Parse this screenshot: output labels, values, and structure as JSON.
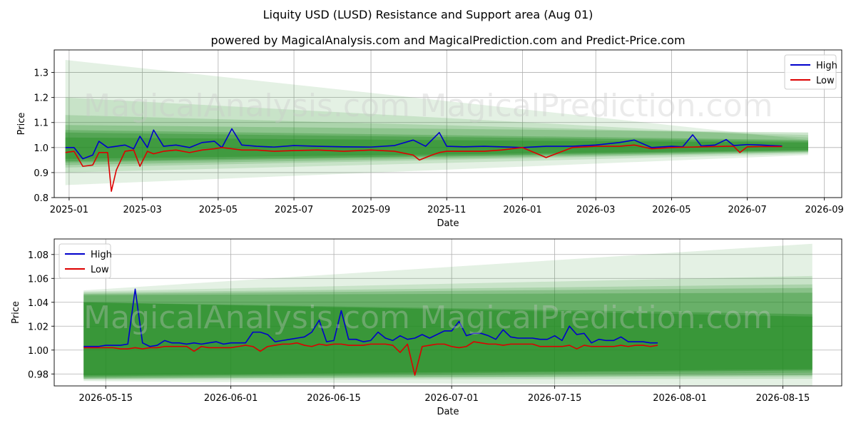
{
  "figure": {
    "title": "Liquity USD (LUSD) Resistance and Support area (Aug 01)",
    "subtitle": "powered by MagicalAnalysis.com and MagicalPrediction.com and Predict-Price.com",
    "watermarks": [
      "MagicalAnalysis.com",
      "MagicalPrediction.com"
    ]
  },
  "colors": {
    "high": "#0000cc",
    "low": "#dd0000",
    "band": "#228b22",
    "grid": "#b0b0b0"
  },
  "chart_data": [
    {
      "type": "line",
      "xlabel": "Date",
      "ylabel": "Price",
      "xlim": [
        "2024-12-20",
        "2026-09-15"
      ],
      "ylim": [
        0.8,
        1.39
      ],
      "grid": true,
      "legend": "top-right",
      "x_ticks": [
        "2025-01",
        "2025-03",
        "2025-05",
        "2025-07",
        "2025-09",
        "2025-11",
        "2026-01",
        "2026-03",
        "2026-05",
        "2026-07",
        "2026-09"
      ],
      "x_tick_dates": [
        "2025-01-01",
        "2025-03-01",
        "2025-05-01",
        "2025-07-01",
        "2025-09-01",
        "2025-11-01",
        "2026-01-01",
        "2026-03-01",
        "2026-05-01",
        "2026-07-01",
        "2026-09-01"
      ],
      "y_ticks": [
        "0.8",
        "0.9",
        "1.0",
        "1.1",
        "1.2",
        "1.3"
      ],
      "y_tick_values": [
        0.8,
        0.9,
        1.0,
        1.1,
        1.2,
        1.3
      ],
      "band_start": "2024-12-29",
      "band_end": "2026-08-19",
      "bands": [
        {
          "start": [
            0.85,
            1.35
          ],
          "end": [
            0.97,
            1.03
          ],
          "opacity": 0.12
        },
        {
          "start": [
            0.9,
            1.2
          ],
          "end": [
            0.975,
            1.04
          ],
          "opacity": 0.14
        },
        {
          "start": [
            0.92,
            1.13
          ],
          "end": [
            0.98,
            1.05
          ],
          "opacity": 0.16
        },
        {
          "start": [
            0.93,
            1.09
          ],
          "end": [
            0.982,
            1.06
          ],
          "opacity": 0.22
        },
        {
          "start": [
            0.94,
            1.07
          ],
          "end": [
            0.985,
            1.03
          ],
          "opacity": 0.28
        },
        {
          "start": [
            0.945,
            1.06
          ],
          "end": [
            0.988,
            1.025
          ],
          "opacity": 0.34
        },
        {
          "start": [
            0.955,
            1.04
          ],
          "end": [
            0.99,
            1.02
          ],
          "opacity": 0.4
        }
      ],
      "series": [
        {
          "name": "High",
          "dates": [
            "2024-12-29",
            "2025-01-05",
            "2025-01-12",
            "2025-01-20",
            "2025-01-25",
            "2025-02-01",
            "2025-02-08",
            "2025-02-15",
            "2025-02-22",
            "2025-02-27",
            "2025-03-05",
            "2025-03-10",
            "2025-03-18",
            "2025-03-28",
            "2025-04-08",
            "2025-04-18",
            "2025-04-28",
            "2025-05-04",
            "2025-05-12",
            "2025-05-20",
            "2025-06-01",
            "2025-06-15",
            "2025-07-01",
            "2025-07-20",
            "2025-08-10",
            "2025-09-01",
            "2025-09-20",
            "2025-10-05",
            "2025-10-15",
            "2025-10-26",
            "2025-11-01",
            "2025-11-15",
            "2025-12-01",
            "2025-12-15",
            "2026-01-01",
            "2026-01-20",
            "2026-02-10",
            "2026-03-01",
            "2026-03-20",
            "2026-04-01",
            "2026-04-15",
            "2026-05-01",
            "2026-05-10",
            "2026-05-18",
            "2026-05-25",
            "2026-06-05",
            "2026-06-14",
            "2026-06-20",
            "2026-07-01",
            "2026-07-12",
            "2026-07-20",
            "2026-07-29"
          ],
          "values": [
            1.0,
            1.0,
            0.955,
            0.97,
            1.025,
            1.0,
            1.005,
            1.01,
            0.995,
            1.045,
            1.0,
            1.07,
            1.005,
            1.01,
            1.0,
            1.02,
            1.025,
            1.0,
            1.075,
            1.01,
            1.005,
            1.002,
            1.008,
            1.005,
            1.003,
            1.002,
            1.008,
            1.03,
            1.005,
            1.06,
            1.005,
            1.003,
            1.005,
            1.003,
            1.0,
            1.005,
            1.005,
            1.01,
            1.02,
            1.03,
            1.0,
            1.005,
            1.003,
            1.051,
            1.006,
            1.01,
            1.032,
            1.008,
            1.012,
            1.01,
            1.008,
            1.006
          ]
        },
        {
          "name": "Low",
          "dates": [
            "2024-12-29",
            "2025-01-05",
            "2025-01-12",
            "2025-01-20",
            "2025-01-25",
            "2025-02-01",
            "2025-02-04",
            "2025-02-08",
            "2025-02-15",
            "2025-02-22",
            "2025-02-27",
            "2025-03-05",
            "2025-03-10",
            "2025-03-18",
            "2025-03-28",
            "2025-04-08",
            "2025-04-18",
            "2025-04-28",
            "2025-05-04",
            "2025-05-12",
            "2025-05-20",
            "2025-06-01",
            "2025-06-15",
            "2025-07-01",
            "2025-07-20",
            "2025-08-10",
            "2025-09-01",
            "2025-09-20",
            "2025-10-05",
            "2025-10-10",
            "2025-10-20",
            "2025-10-26",
            "2025-11-01",
            "2025-11-15",
            "2025-12-01",
            "2025-12-15",
            "2026-01-01",
            "2026-01-20",
            "2026-02-10",
            "2026-03-01",
            "2026-03-20",
            "2026-04-01",
            "2026-04-15",
            "2026-05-01",
            "2026-05-18",
            "2026-05-25",
            "2026-06-05",
            "2026-06-14",
            "2026-06-20",
            "2026-06-25",
            "2026-07-01",
            "2026-07-12",
            "2026-07-20",
            "2026-07-29"
          ],
          "values": [
            0.98,
            0.985,
            0.925,
            0.93,
            0.98,
            0.98,
            0.825,
            0.91,
            0.985,
            0.99,
            0.925,
            0.985,
            0.975,
            0.985,
            0.99,
            0.98,
            0.99,
            0.995,
            1.0,
            0.995,
            0.99,
            0.99,
            0.985,
            0.988,
            0.99,
            0.985,
            0.99,
            0.985,
            0.97,
            0.95,
            0.97,
            0.98,
            0.985,
            0.985,
            0.985,
            0.99,
            1.0,
            0.96,
            1.0,
            1.005,
            1.005,
            1.01,
            0.995,
            1.0,
            1.002,
            1.003,
            1.004,
            1.005,
            1.005,
            0.98,
            1.003,
            1.004,
            1.004,
            1.004
          ]
        }
      ]
    },
    {
      "type": "line",
      "xlabel": "Date",
      "ylabel": "Price",
      "xlim": [
        "2026-05-08",
        "2026-08-23"
      ],
      "ylim": [
        0.97,
        1.093
      ],
      "grid": true,
      "legend": "top-left",
      "x_ticks": [
        "2026-05-15",
        "2026-06-01",
        "2026-06-15",
        "2026-07-01",
        "2026-07-15",
        "2026-08-01",
        "2026-08-15"
      ],
      "y_ticks": [
        "0.98",
        "1.00",
        "1.02",
        "1.04",
        "1.06",
        "1.08"
      ],
      "y_tick_values": [
        0.98,
        1.0,
        1.02,
        1.04,
        1.06,
        1.08
      ],
      "band_start": "2026-05-12",
      "band_end": "2026-08-19",
      "bands": [
        {
          "start": [
            0.974,
            1.05
          ],
          "end": [
            0.97,
            1.089
          ],
          "opacity": 0.12
        },
        {
          "start": [
            0.975,
            1.049
          ],
          "end": [
            0.976,
            1.062
          ],
          "opacity": 0.14
        },
        {
          "start": [
            0.976,
            1.048
          ],
          "end": [
            0.978,
            1.055
          ],
          "opacity": 0.18
        },
        {
          "start": [
            0.976,
            1.047
          ],
          "end": [
            0.979,
            1.052
          ],
          "opacity": 0.24
        },
        {
          "start": [
            0.977,
            1.046
          ],
          "end": [
            0.981,
            1.048
          ],
          "opacity": 0.3
        },
        {
          "start": [
            0.978,
            1.04
          ],
          "end": [
            0.983,
            1.03
          ],
          "opacity": 0.4
        },
        {
          "start": [
            0.979,
            1.04
          ],
          "end": [
            0.984,
            1.028
          ],
          "opacity": 0.45
        }
      ],
      "series": [
        {
          "name": "High",
          "dates": [
            "2026-05-12",
            "2026-05-13",
            "2026-05-14",
            "2026-05-15",
            "2026-05-16",
            "2026-05-17",
            "2026-05-18",
            "2026-05-19",
            "2026-05-20",
            "2026-05-21",
            "2026-05-22",
            "2026-05-23",
            "2026-05-24",
            "2026-05-25",
            "2026-05-26",
            "2026-05-27",
            "2026-05-28",
            "2026-05-29",
            "2026-05-30",
            "2026-05-31",
            "2026-06-01",
            "2026-06-02",
            "2026-06-03",
            "2026-06-04",
            "2026-06-05",
            "2026-06-06",
            "2026-06-07",
            "2026-06-08",
            "2026-06-09",
            "2026-06-10",
            "2026-06-11",
            "2026-06-12",
            "2026-06-13",
            "2026-06-14",
            "2026-06-15",
            "2026-06-16",
            "2026-06-17",
            "2026-06-18",
            "2026-06-19",
            "2026-06-20",
            "2026-06-21",
            "2026-06-22",
            "2026-06-23",
            "2026-06-24",
            "2026-06-25",
            "2026-06-26",
            "2026-06-27",
            "2026-06-28",
            "2026-06-29",
            "2026-06-30",
            "2026-07-01",
            "2026-07-02",
            "2026-07-03",
            "2026-07-04",
            "2026-07-05",
            "2026-07-06",
            "2026-07-07",
            "2026-07-08",
            "2026-07-09",
            "2026-07-10",
            "2026-07-11",
            "2026-07-12",
            "2026-07-13",
            "2026-07-14",
            "2026-07-15",
            "2026-07-16",
            "2026-07-17",
            "2026-07-18",
            "2026-07-19",
            "2026-07-20",
            "2026-07-21",
            "2026-07-22",
            "2026-07-23",
            "2026-07-24",
            "2026-07-25",
            "2026-07-26",
            "2026-07-27",
            "2026-07-28",
            "2026-07-29"
          ],
          "values": [
            1.003,
            1.003,
            1.003,
            1.004,
            1.004,
            1.004,
            1.005,
            1.051,
            1.006,
            1.003,
            1.004,
            1.008,
            1.006,
            1.006,
            1.005,
            1.006,
            1.005,
            1.006,
            1.007,
            1.005,
            1.006,
            1.006,
            1.006,
            1.015,
            1.015,
            1.013,
            1.007,
            1.008,
            1.009,
            1.01,
            1.011,
            1.015,
            1.025,
            1.007,
            1.008,
            1.033,
            1.009,
            1.009,
            1.007,
            1.008,
            1.015,
            1.01,
            1.008,
            1.012,
            1.009,
            1.01,
            1.013,
            1.01,
            1.013,
            1.016,
            1.016,
            1.024,
            1.012,
            1.014,
            1.014,
            1.012,
            1.009,
            1.017,
            1.011,
            1.01,
            1.01,
            1.01,
            1.009,
            1.009,
            1.012,
            1.008,
            1.02,
            1.013,
            1.014,
            1.006,
            1.009,
            1.008,
            1.008,
            1.011,
            1.007,
            1.007,
            1.007,
            1.006,
            1.006
          ]
        },
        {
          "name": "Low",
          "dates": [
            "2026-05-12",
            "2026-05-13",
            "2026-05-14",
            "2026-05-15",
            "2026-05-16",
            "2026-05-17",
            "2026-05-18",
            "2026-05-19",
            "2026-05-20",
            "2026-05-21",
            "2026-05-22",
            "2026-05-23",
            "2026-05-24",
            "2026-05-25",
            "2026-05-26",
            "2026-05-27",
            "2026-05-28",
            "2026-05-29",
            "2026-05-30",
            "2026-05-31",
            "2026-06-01",
            "2026-06-02",
            "2026-06-03",
            "2026-06-04",
            "2026-06-05",
            "2026-06-06",
            "2026-06-07",
            "2026-06-08",
            "2026-06-09",
            "2026-06-10",
            "2026-06-11",
            "2026-06-12",
            "2026-06-13",
            "2026-06-14",
            "2026-06-15",
            "2026-06-16",
            "2026-06-17",
            "2026-06-18",
            "2026-06-19",
            "2026-06-20",
            "2026-06-21",
            "2026-06-22",
            "2026-06-23",
            "2026-06-24",
            "2026-06-25",
            "2026-06-26",
            "2026-06-27",
            "2026-06-28",
            "2026-06-29",
            "2026-06-30",
            "2026-07-01",
            "2026-07-02",
            "2026-07-03",
            "2026-07-04",
            "2026-07-05",
            "2026-07-06",
            "2026-07-07",
            "2026-07-08",
            "2026-07-09",
            "2026-07-10",
            "2026-07-11",
            "2026-07-12",
            "2026-07-13",
            "2026-07-14",
            "2026-07-15",
            "2026-07-16",
            "2026-07-17",
            "2026-07-18",
            "2026-07-19",
            "2026-07-20",
            "2026-07-21",
            "2026-07-22",
            "2026-07-23",
            "2026-07-24",
            "2026-07-25",
            "2026-07-26",
            "2026-07-27",
            "2026-07-28",
            "2026-07-29"
          ],
          "values": [
            1.002,
            1.002,
            1.002,
            1.002,
            1.002,
            1.001,
            1.001,
            1.002,
            1.001,
            1.002,
            1.002,
            1.003,
            1.003,
            1.003,
            1.003,
            0.999,
            1.003,
            1.002,
            1.002,
            1.002,
            1.002,
            1.003,
            1.004,
            1.003,
            0.999,
            1.003,
            1.004,
            1.005,
            1.005,
            1.006,
            1.004,
            1.003,
            1.005,
            1.004,
            1.005,
            1.005,
            1.004,
            1.004,
            1.004,
            1.005,
            1.005,
            1.005,
            1.004,
            0.998,
            1.005,
            0.979,
            1.003,
            1.004,
            1.005,
            1.005,
            1.003,
            1.002,
            1.003,
            1.007,
            1.006,
            1.005,
            1.005,
            1.004,
            1.005,
            1.005,
            1.005,
            1.005,
            1.003,
            1.003,
            1.003,
            1.003,
            1.004,
            1.001,
            1.004,
            1.003,
            1.003,
            1.003,
            1.003,
            1.004,
            1.003,
            1.004,
            1.004,
            1.003,
            1.004
          ]
        }
      ]
    }
  ]
}
